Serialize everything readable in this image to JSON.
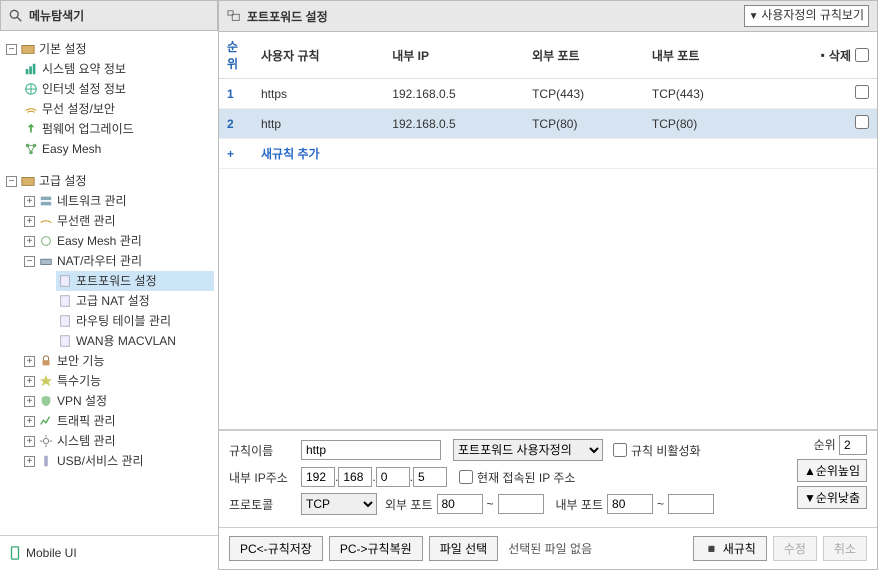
{
  "sidebar": {
    "title": "메뉴탐색기",
    "basic": {
      "label": "기본 설정",
      "items": [
        "시스템 요약 정보",
        "인터넷 설정 정보",
        "무선 설정/보안",
        "펌웨어 업그레이드",
        "Easy Mesh"
      ]
    },
    "advanced": {
      "label": "고급 설정",
      "items": [
        "네트워크 관리",
        "무선랜 관리",
        "Easy Mesh 관리"
      ],
      "nat": {
        "label": "NAT/라우터 관리",
        "children": [
          "포트포워드 설정",
          "고급 NAT 설정",
          "라우팅 테이블 관리",
          "WAN용 MACVLAN"
        ]
      },
      "rest": [
        "보안 기능",
        "특수기능",
        "VPN 설정",
        "트래픽 관리",
        "시스템 관리",
        "USB/서비스 관리"
      ]
    },
    "mobile": "Mobile UI"
  },
  "header": {
    "title": "포트포워드 설정",
    "view_select": "사용자정의 규칙보기"
  },
  "table": {
    "cols": [
      "순위",
      "사용자 규칙",
      "내부 IP",
      "외부 포트",
      "내부 포트"
    ],
    "delete_label": "삭제",
    "rows": [
      {
        "seq": "1",
        "rule": "https",
        "ip": "192.168.0.5",
        "ext": "TCP(443)",
        "int": "TCP(443)",
        "selected": false
      },
      {
        "seq": "2",
        "rule": "http",
        "ip": "192.168.0.5",
        "ext": "TCP(80)",
        "int": "TCP(80)",
        "selected": true
      }
    ],
    "add": {
      "plus": "+",
      "label": "새규칙 추가"
    }
  },
  "form": {
    "rule_name_label": "규칙이름",
    "rule_name_value": "http",
    "type_select": "포트포워드 사용자정의",
    "disable_label": "규칙 비활성화",
    "ip_label": "내부 IP주소",
    "ip": [
      "192",
      "168",
      "0",
      "5"
    ],
    "ip_dot": ".",
    "current_ip_label": "현재 접속된 IP 주소",
    "proto_label": "프로토콜",
    "proto_value": "TCP",
    "ext_port_label": "외부 포트",
    "ext_port_from": "80",
    "ext_port_to": "",
    "int_port_label": "내부 포트",
    "int_port_from": "80",
    "int_port_to": "",
    "tilde": "~",
    "order_label": "순위",
    "order_value": "2",
    "order_up": "▲순위높임",
    "order_down": "▼순위낮춤"
  },
  "footer": {
    "save": "PC<-규칙저장",
    "restore": "PC->규칙복원",
    "file_select": "파일 선택",
    "file_status": "선택된 파일 없음",
    "new_rule": "새규칙",
    "edit": "수정",
    "cancel": "취소",
    "new_prefix": "◾"
  }
}
